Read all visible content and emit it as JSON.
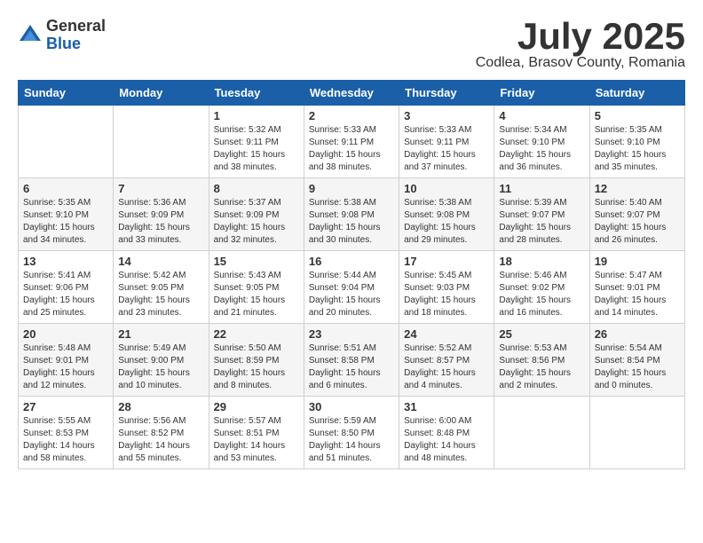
{
  "logo": {
    "general": "General",
    "blue": "Blue"
  },
  "title": "July 2025",
  "location": "Codlea, Brasov County, Romania",
  "weekdays": [
    "Sunday",
    "Monday",
    "Tuesday",
    "Wednesday",
    "Thursday",
    "Friday",
    "Saturday"
  ],
  "weeks": [
    [
      {
        "day": "",
        "info": ""
      },
      {
        "day": "",
        "info": ""
      },
      {
        "day": "1",
        "info": "Sunrise: 5:32 AM\nSunset: 9:11 PM\nDaylight: 15 hours\nand 38 minutes."
      },
      {
        "day": "2",
        "info": "Sunrise: 5:33 AM\nSunset: 9:11 PM\nDaylight: 15 hours\nand 38 minutes."
      },
      {
        "day": "3",
        "info": "Sunrise: 5:33 AM\nSunset: 9:11 PM\nDaylight: 15 hours\nand 37 minutes."
      },
      {
        "day": "4",
        "info": "Sunrise: 5:34 AM\nSunset: 9:10 PM\nDaylight: 15 hours\nand 36 minutes."
      },
      {
        "day": "5",
        "info": "Sunrise: 5:35 AM\nSunset: 9:10 PM\nDaylight: 15 hours\nand 35 minutes."
      }
    ],
    [
      {
        "day": "6",
        "info": "Sunrise: 5:35 AM\nSunset: 9:10 PM\nDaylight: 15 hours\nand 34 minutes."
      },
      {
        "day": "7",
        "info": "Sunrise: 5:36 AM\nSunset: 9:09 PM\nDaylight: 15 hours\nand 33 minutes."
      },
      {
        "day": "8",
        "info": "Sunrise: 5:37 AM\nSunset: 9:09 PM\nDaylight: 15 hours\nand 32 minutes."
      },
      {
        "day": "9",
        "info": "Sunrise: 5:38 AM\nSunset: 9:08 PM\nDaylight: 15 hours\nand 30 minutes."
      },
      {
        "day": "10",
        "info": "Sunrise: 5:38 AM\nSunset: 9:08 PM\nDaylight: 15 hours\nand 29 minutes."
      },
      {
        "day": "11",
        "info": "Sunrise: 5:39 AM\nSunset: 9:07 PM\nDaylight: 15 hours\nand 28 minutes."
      },
      {
        "day": "12",
        "info": "Sunrise: 5:40 AM\nSunset: 9:07 PM\nDaylight: 15 hours\nand 26 minutes."
      }
    ],
    [
      {
        "day": "13",
        "info": "Sunrise: 5:41 AM\nSunset: 9:06 PM\nDaylight: 15 hours\nand 25 minutes."
      },
      {
        "day": "14",
        "info": "Sunrise: 5:42 AM\nSunset: 9:05 PM\nDaylight: 15 hours\nand 23 minutes."
      },
      {
        "day": "15",
        "info": "Sunrise: 5:43 AM\nSunset: 9:05 PM\nDaylight: 15 hours\nand 21 minutes."
      },
      {
        "day": "16",
        "info": "Sunrise: 5:44 AM\nSunset: 9:04 PM\nDaylight: 15 hours\nand 20 minutes."
      },
      {
        "day": "17",
        "info": "Sunrise: 5:45 AM\nSunset: 9:03 PM\nDaylight: 15 hours\nand 18 minutes."
      },
      {
        "day": "18",
        "info": "Sunrise: 5:46 AM\nSunset: 9:02 PM\nDaylight: 15 hours\nand 16 minutes."
      },
      {
        "day": "19",
        "info": "Sunrise: 5:47 AM\nSunset: 9:01 PM\nDaylight: 15 hours\nand 14 minutes."
      }
    ],
    [
      {
        "day": "20",
        "info": "Sunrise: 5:48 AM\nSunset: 9:01 PM\nDaylight: 15 hours\nand 12 minutes."
      },
      {
        "day": "21",
        "info": "Sunrise: 5:49 AM\nSunset: 9:00 PM\nDaylight: 15 hours\nand 10 minutes."
      },
      {
        "day": "22",
        "info": "Sunrise: 5:50 AM\nSunset: 8:59 PM\nDaylight: 15 hours\nand 8 minutes."
      },
      {
        "day": "23",
        "info": "Sunrise: 5:51 AM\nSunset: 8:58 PM\nDaylight: 15 hours\nand 6 minutes."
      },
      {
        "day": "24",
        "info": "Sunrise: 5:52 AM\nSunset: 8:57 PM\nDaylight: 15 hours\nand 4 minutes."
      },
      {
        "day": "25",
        "info": "Sunrise: 5:53 AM\nSunset: 8:56 PM\nDaylight: 15 hours\nand 2 minutes."
      },
      {
        "day": "26",
        "info": "Sunrise: 5:54 AM\nSunset: 8:54 PM\nDaylight: 15 hours\nand 0 minutes."
      }
    ],
    [
      {
        "day": "27",
        "info": "Sunrise: 5:55 AM\nSunset: 8:53 PM\nDaylight: 14 hours\nand 58 minutes."
      },
      {
        "day": "28",
        "info": "Sunrise: 5:56 AM\nSunset: 8:52 PM\nDaylight: 14 hours\nand 55 minutes."
      },
      {
        "day": "29",
        "info": "Sunrise: 5:57 AM\nSunset: 8:51 PM\nDaylight: 14 hours\nand 53 minutes."
      },
      {
        "day": "30",
        "info": "Sunrise: 5:59 AM\nSunset: 8:50 PM\nDaylight: 14 hours\nand 51 minutes."
      },
      {
        "day": "31",
        "info": "Sunrise: 6:00 AM\nSunset: 8:48 PM\nDaylight: 14 hours\nand 48 minutes."
      },
      {
        "day": "",
        "info": ""
      },
      {
        "day": "",
        "info": ""
      }
    ]
  ]
}
